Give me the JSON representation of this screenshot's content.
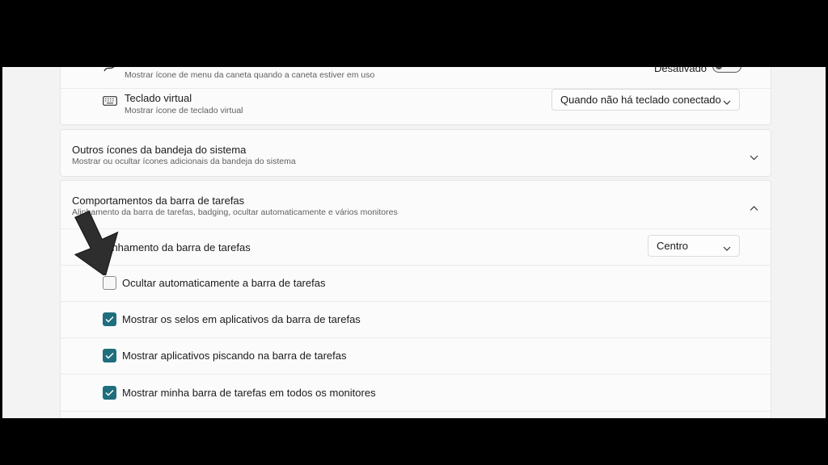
{
  "pen_row": {
    "subtitle": "Mostrar ícone de menu da caneta quando a caneta estiver em uso",
    "toggle_label": "Desativado",
    "toggle_on": false
  },
  "keyboard_row": {
    "title": "Teclado virtual",
    "subtitle": "Mostrar ícone de teclado virtual",
    "dropdown_value": "Quando não há teclado conectado"
  },
  "tray_section": {
    "title": "Outros ícones da bandeja do sistema",
    "subtitle": "Mostrar ou ocultar ícones adicionais da bandeja do sistema"
  },
  "behaviors_section": {
    "title": "Comportamentos da barra de tarefas",
    "subtitle": "Alinhamento da barra de tarefas, badging, ocultar automaticamente e vários monitores",
    "alignment": {
      "label": "Alinhamento da barra de tarefas",
      "value": "Centro"
    },
    "options": [
      {
        "label": "Ocultar automaticamente a barra de tarefas",
        "checked": false
      },
      {
        "label": "Mostrar os selos em aplicativos da barra de tarefas",
        "checked": true
      },
      {
        "label": "Mostrar aplicativos piscando na barra de tarefas",
        "checked": true
      },
      {
        "label": "Mostrar minha barra de tarefas em todos os monitores",
        "checked": true
      }
    ]
  },
  "colors": {
    "accent": "#1f6e7e",
    "background": "#f3f3f3",
    "card": "#fbfbfb"
  }
}
